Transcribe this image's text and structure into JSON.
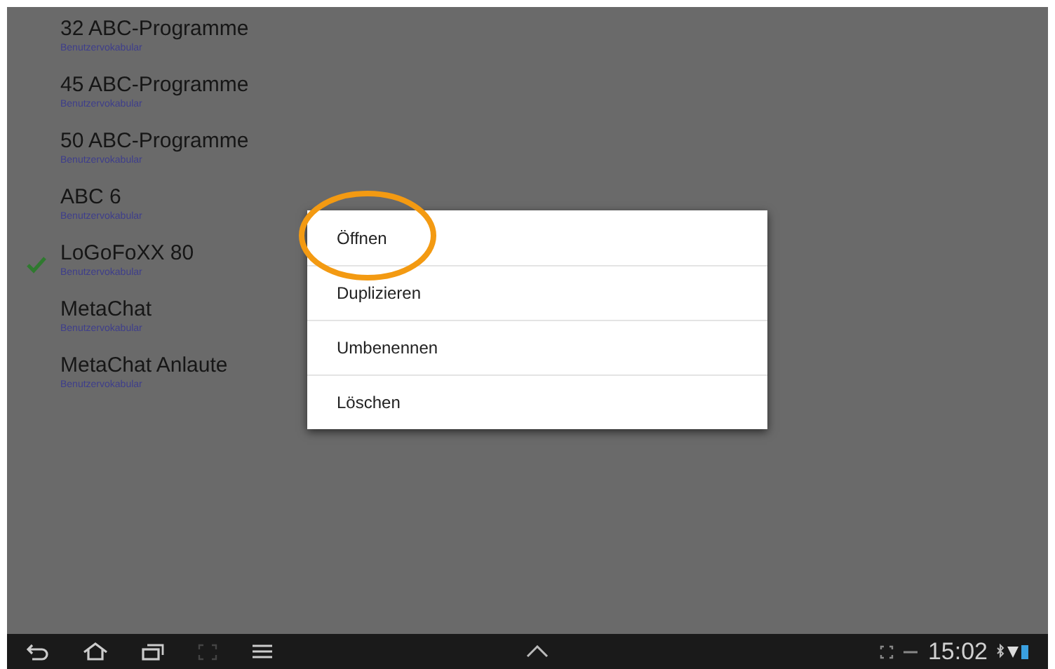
{
  "list": [
    {
      "title": "32 ABC-Programme",
      "subtitle": "Benutzervokabular",
      "checked": false
    },
    {
      "title": "45 ABC-Programme",
      "subtitle": "Benutzervokabular",
      "checked": false
    },
    {
      "title": "50 ABC-Programme",
      "subtitle": "Benutzervokabular",
      "checked": false
    },
    {
      "title": "ABC 6",
      "subtitle": "Benutzervokabular",
      "checked": false
    },
    {
      "title": "LoGoFoXX 80",
      "subtitle": "Benutzervokabular",
      "checked": true
    },
    {
      "title": "MetaChat",
      "subtitle": "Benutzervokabular",
      "checked": false
    },
    {
      "title": "MetaChat Anlaute",
      "subtitle": "Benutzervokabular",
      "checked": false
    }
  ],
  "context_menu": {
    "items": [
      {
        "label": "Öffnen",
        "highlighted": true
      },
      {
        "label": "Duplizieren",
        "highlighted": false
      },
      {
        "label": "Umbenennen",
        "highlighted": false
      },
      {
        "label": "Löschen",
        "highlighted": false
      }
    ]
  },
  "status_bar": {
    "time": "15:02"
  }
}
